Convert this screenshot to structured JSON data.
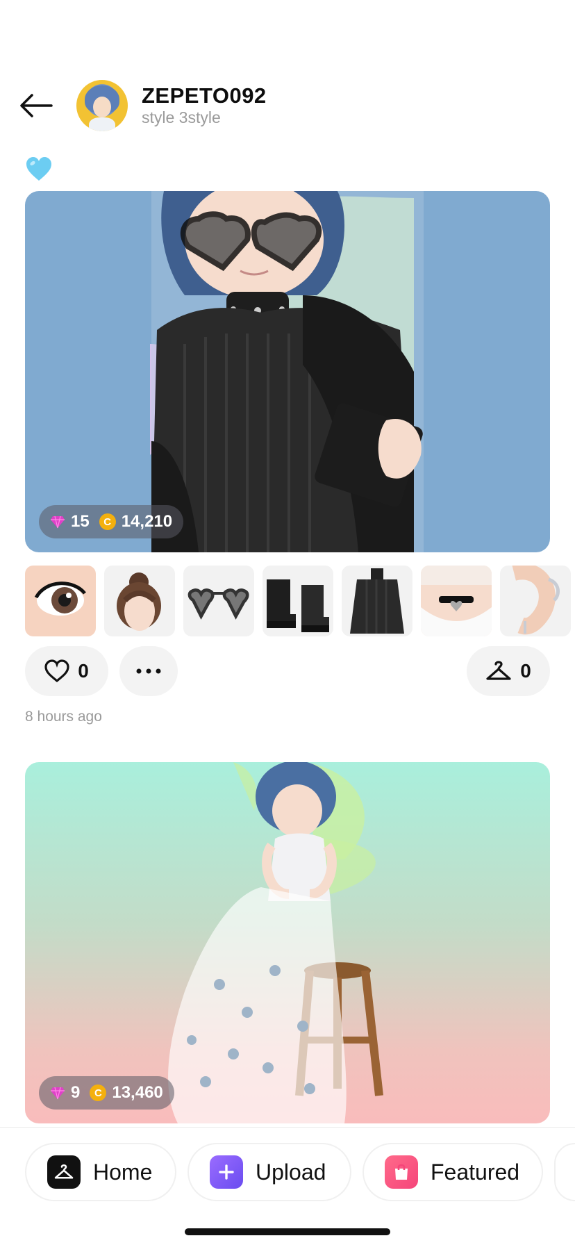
{
  "header": {
    "username": "ZEPETO092",
    "subtitle": "style 3style"
  },
  "posts": [
    {
      "caption_emoji": "light-blue-heart",
      "price": {
        "gems": "15",
        "coins": "14,210"
      },
      "items": [
        "eye-lens",
        "messy-bun-hair",
        "heart-sunglasses",
        "black-platform-boots",
        "black-knit-outfit",
        "heart-choker",
        "silver-ear-cuff"
      ],
      "likes": "0",
      "wear_count": "0",
      "timestamp": "8 hours ago"
    },
    {
      "price": {
        "gems": "9",
        "coins": "13,460"
      }
    }
  ],
  "coin_symbol": "C",
  "nav": {
    "home": "Home",
    "upload": "Upload",
    "featured": "Featured"
  },
  "colors": {
    "post1_bg": "#80aad0",
    "gem": "#e040c8",
    "coin": "#f4b00e",
    "upload_accent": "#7a5cf5",
    "featured_accent": "#f5457a"
  }
}
